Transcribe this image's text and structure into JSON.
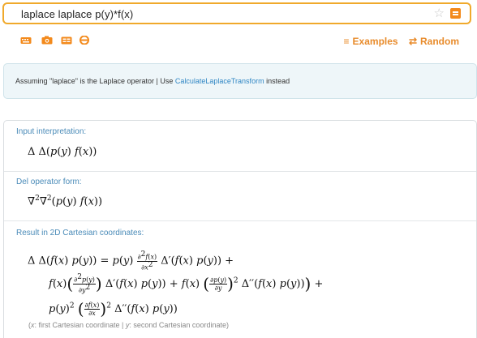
{
  "search": {
    "query": "laplace laplace p(y)*f(x)"
  },
  "toolbar": {
    "icons": [
      "keyboard-icon",
      "camera-icon",
      "examples-grid-icon",
      "random-link-icon"
    ],
    "examples_label": "Examples",
    "random_label": "Random"
  },
  "assumption": {
    "prefix": "Assuming \"laplace\" is the Laplace operator | Use ",
    "link": "CalculateLaplaceTransform",
    "suffix": " instead"
  },
  "pods": {
    "input": {
      "title": "Input interpretation:",
      "expression": "Δ Δ(p(y) f(x))"
    },
    "del": {
      "title": "Del operator form:",
      "expression": "∇²∇²(p(y) f(x))"
    },
    "result": {
      "title": "Result in 2D Cartesian coordinates:",
      "line1_lhs": "Δ Δ(f(x) p(y)) = ",
      "line1_rhs": "p(y) ∂²f(x)/∂x² Δ′(f(x) p(y)) +",
      "line2": "f(x) (∂²p(y)/∂y²) Δ′(f(x) p(y)) + f(x) (∂p(y)/∂y)² Δ′′(f(x) p(y)) +",
      "line3": "p(y)² (∂f(x)/∂x)² Δ′′(f(x) p(y))",
      "footnote_x": "x",
      "footnote_x_text": ": first Cartesian coordinate | ",
      "footnote_y": "y",
      "footnote_y_text": ": second Cartesian coordinate"
    }
  },
  "colors": {
    "accent_orange": "#f38a1c",
    "link_blue": "#2f86c4",
    "pod_title_blue": "#4a8bb8"
  }
}
